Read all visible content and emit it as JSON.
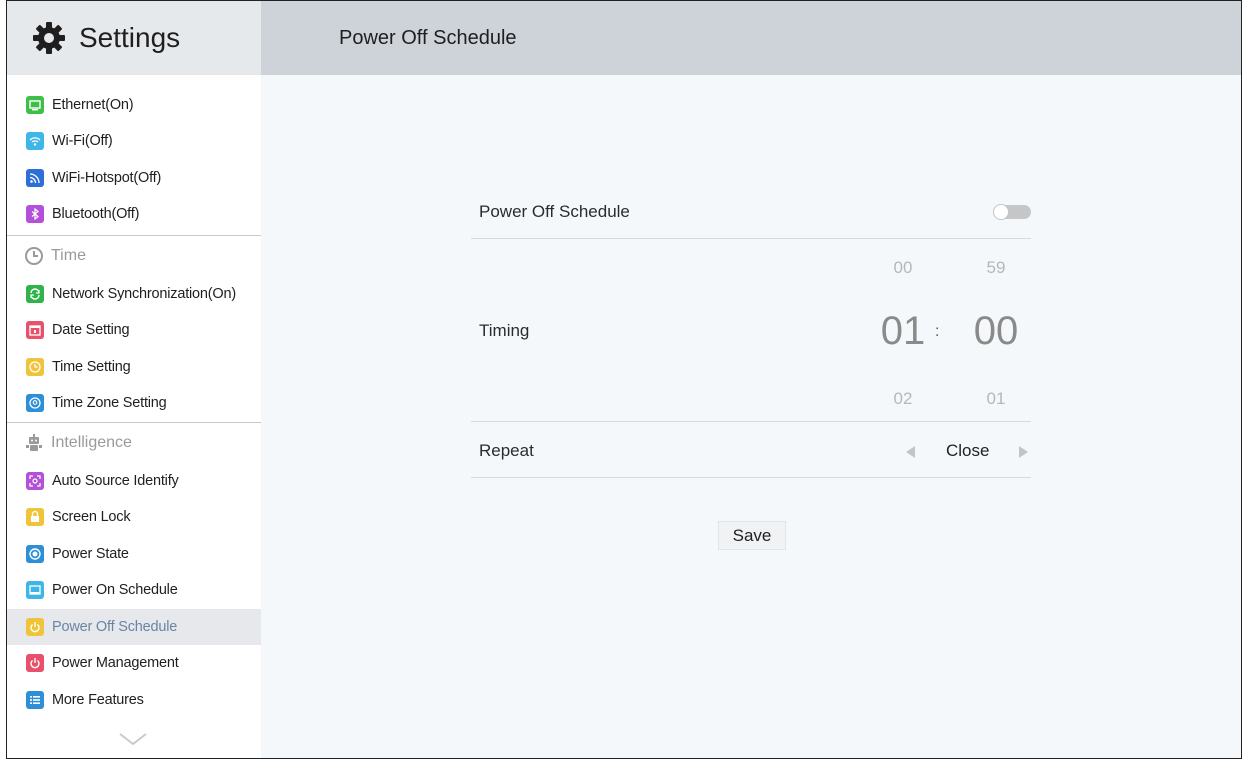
{
  "app": {
    "title": "Settings",
    "icon": "gear-icon"
  },
  "page": {
    "title": "Power Off Schedule"
  },
  "sidebar": {
    "network_items": [
      {
        "label": "Ethernet(On)",
        "icon": "monitor-icon",
        "color": "#3fbf4a"
      },
      {
        "label": "Wi-Fi(Off)",
        "icon": "wifi-icon",
        "color": "#3eb6e8"
      },
      {
        "label": "WiFi-Hotspot(Off)",
        "icon": "hotspot-icon",
        "color": "#2d6fd6"
      },
      {
        "label": "Bluetooth(Off)",
        "icon": "bluetooth-icon",
        "color": "#b34fd9"
      }
    ],
    "time_header": {
      "label": "Time",
      "icon": "clock-icon"
    },
    "time_items": [
      {
        "label": "Network Synchronization(On)",
        "icon": "sync-icon",
        "color": "#2fb34a"
      },
      {
        "label": "Date Setting",
        "icon": "calendar-icon",
        "color": "#e8506b"
      },
      {
        "label": "Time Setting",
        "icon": "clock-icon",
        "color": "#f0c43a"
      },
      {
        "label": "Time Zone Setting",
        "icon": "globe-icon",
        "color": "#2d8fd6"
      }
    ],
    "intelligence_header": {
      "label": "Intelligence",
      "icon": "robot-icon"
    },
    "intelligence_items": [
      {
        "label": "Auto Source Identify",
        "icon": "scan-icon",
        "color": "#b34fd9"
      },
      {
        "label": "Screen Lock",
        "icon": "lock-icon",
        "color": "#f0c43a"
      },
      {
        "label": "Power State",
        "icon": "power-state-icon",
        "color": "#2d8fd6"
      },
      {
        "label": "Power On Schedule",
        "icon": "screen-icon",
        "color": "#3eb6e8"
      },
      {
        "label": "Power Off Schedule",
        "icon": "power-icon",
        "color": "#f0c43a"
      },
      {
        "label": "Power Management",
        "icon": "power-icon",
        "color": "#e8506b"
      },
      {
        "label": "More Features",
        "icon": "list-icon",
        "color": "#2d8fd6"
      }
    ],
    "selected_item": "Power Off Schedule",
    "more_icon": "chevron-down-icon"
  },
  "main": {
    "schedule_label": "Power Off Schedule",
    "schedule_enabled": false,
    "timing": {
      "label": "Timing",
      "hour_prev": "00",
      "hour": "01",
      "hour_next": "02",
      "separator": ":",
      "minute_prev": "59",
      "minute": "00",
      "minute_next": "01"
    },
    "repeat": {
      "label": "Repeat",
      "value": "Close"
    },
    "save_label": "Save"
  },
  "colors": {
    "header_left_bg": "#e6e9ec",
    "header_right_bg": "#cdd3d8",
    "content_bg": "#f4f8fb",
    "selected_text": "#6a84a6"
  }
}
